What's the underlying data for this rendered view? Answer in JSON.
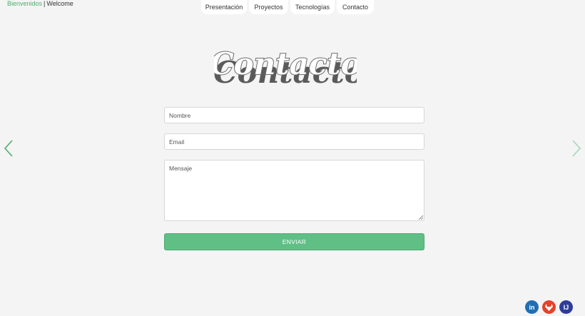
{
  "lang": {
    "active": "Bienvenidos",
    "separator": "|",
    "other": "Welcome"
  },
  "nav": {
    "items": [
      "Presentación",
      "Proyectos",
      "Tecnologías",
      "Contacto"
    ]
  },
  "heading": {
    "title": "Contacto",
    "color": "#6b6b6b"
  },
  "form": {
    "name_placeholder": "Nombre",
    "email_placeholder": "Email",
    "message_placeholder": "Mensaje",
    "submit_label": "ENVIAR",
    "accent": "#5fbf85"
  },
  "carousel": {
    "prev_icon": "chevron-left-icon",
    "next_icon": "chevron-right-icon"
  },
  "social": {
    "linkedin_label": "in",
    "gitlab_icon": "gitlab-icon",
    "intellij_label": "IJ"
  }
}
